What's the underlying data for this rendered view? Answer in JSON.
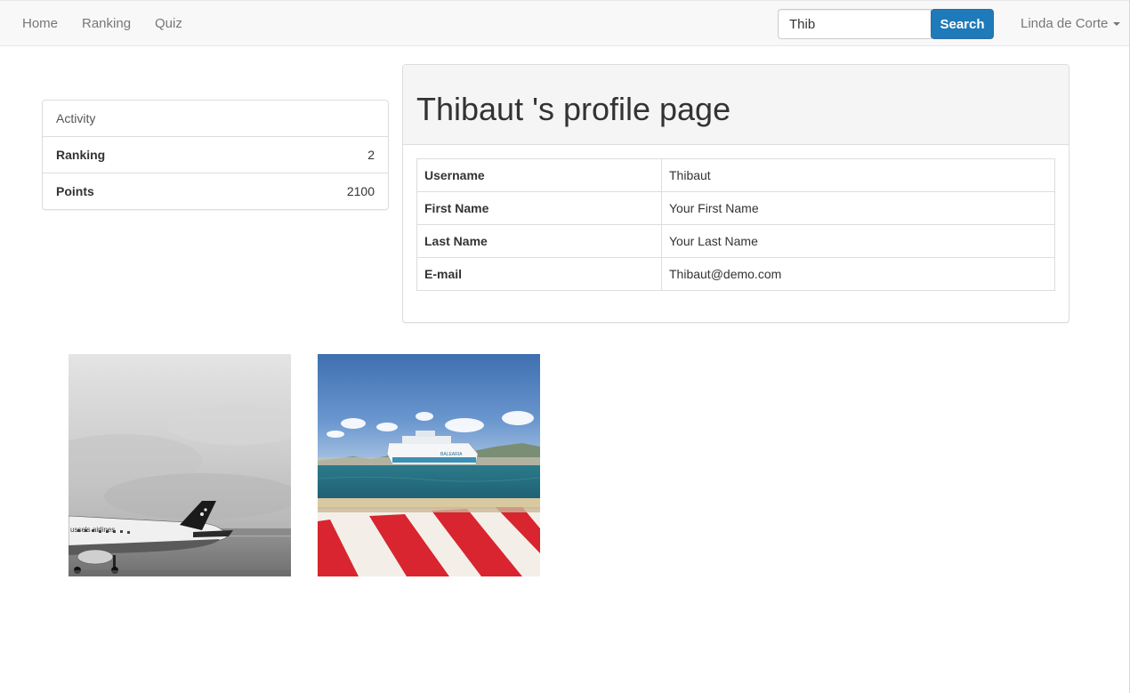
{
  "nav": {
    "links": [
      "Home",
      "Ranking",
      "Quiz"
    ],
    "search": {
      "value": "Thib",
      "button_label": "Search"
    },
    "user": {
      "name": "Linda de Corte"
    }
  },
  "activity": {
    "heading": "Activity",
    "rows": [
      {
        "label": "Ranking",
        "value": "2"
      },
      {
        "label": "Points",
        "value": "2100"
      }
    ]
  },
  "profile": {
    "title": "Thibaut 's profile page",
    "fields": [
      {
        "label": "Username",
        "value": "Thibaut"
      },
      {
        "label": "First Name",
        "value": "Your First Name"
      },
      {
        "label": "Last Name",
        "value": "Your Last Name"
      },
      {
        "label": "E-mail",
        "value": "Thibaut@demo.com"
      }
    ]
  },
  "photos": [
    {
      "subject": "airplane-photo",
      "caption_in_image": "ussels airlines"
    },
    {
      "subject": "ferry-harbour-photo",
      "caption_in_image": "BALEARIA"
    }
  ],
  "colors": {
    "primary_button": "#1f7ab9",
    "navbar_bg": "#f8f8f8",
    "panel_heading_bg": "#f5f5f5"
  }
}
